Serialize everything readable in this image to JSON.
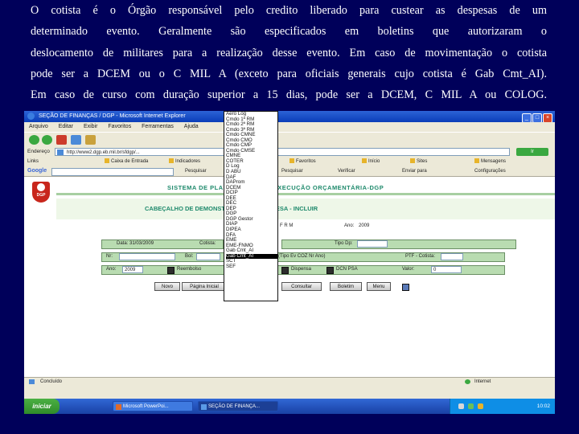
{
  "slide": {
    "lines": [
      "O cotista é o Órgão responsável pelo credito liberado para custear as despesas de um",
      "determinado evento. Geralmente são especificados em boletins que autorizaram o",
      "deslocamento de militares para a realização desse evento. Em caso de movimentação o cotista",
      "pode ser a DCEM ou o C MIL A (exceto para oficiais generais cujo cotista é Gab Cmt_AI).",
      "Em caso de curso com duração superior a 15 dias, pode ser a DCEM, C MIL A ou COLOG."
    ]
  },
  "window": {
    "title": "SEÇÃO DE FINANÇAS / DGP - Microsoft Internet Explorer",
    "menu": [
      "Arquivo",
      "Editar",
      "Exibir",
      "Favoritos",
      "Ferramentas",
      "Ajuda"
    ],
    "address_label": "Endereço",
    "address_value": "http://www2.dgp.eb.mil.br/sfdgp/...",
    "go_label": "Ir",
    "links": [
      "Links",
      "Caixa de Entrada",
      "Indicadores",
      "Favoritos",
      "Início",
      "Sites",
      "Mensagens"
    ],
    "google": {
      "logo": "Google",
      "items": [
        "Pesquisar",
        "Pesquisar",
        "Verificar",
        "Enviar para",
        "Configurações"
      ]
    }
  },
  "page": {
    "system_title": "SISTEMA DE PLANEJAMENTO E EXECUÇÃO ORÇAMENTÁRIA-DGP",
    "form_title": "CABEÇALHO DE DEMONSTRATIVO DA DESPESA - INCLUIR",
    "om_value": "F R M",
    "ano_label": "Ano:",
    "ano_value": "2009",
    "data_label": "Data: 31/03/2009",
    "cotista_label": "Cotista:",
    "tipo_label": "Tipo Dp:",
    "bol_label": "Bol:",
    "tipo_ev_label": "(Tipo Ev   COZ   Nr   Ano)",
    "ptf_label": "PTF - Cotista:",
    "nr_label": "Nr:",
    "ano2_label": "Ano:",
    "ano2_value": "2009",
    "check_labels": [
      "Reembolso",
      "Dispensa",
      "DCN PSA"
    ],
    "valor_label": "Valor:",
    "valor_value": "0",
    "buttons": [
      "Novo",
      "Página Inicial",
      "Consultar",
      "Boletim",
      "Menu"
    ],
    "dropdown_options": [
      "Aero Log",
      "Cmdo 1ª RM",
      "Cmdo 2ª RM",
      "Cmdo 3ª RM",
      "Cmdo CMNE",
      "Cmdo CMO",
      "Cmdo CMP",
      "Cmdo CMSE",
      "CMNE",
      "COTER",
      "D Log",
      "D ABU",
      "DAF",
      "DAProm",
      "DCEM",
      "DCIP",
      "DEE",
      "DEC",
      "DEP",
      "DGP",
      "DGP Gestor",
      "DIAP",
      "DIPEA",
      "DFA",
      "EME",
      "EME-FNMO",
      "Gab Cmt_AI",
      "Gab Cmt_AI",
      "SCT",
      "SEF"
    ],
    "dropdown_selected_index": 27
  },
  "status": {
    "left": "Concluído",
    "zone": "Internet"
  },
  "taskbar": {
    "start": "iniciar",
    "tasks": [
      "Microsoft PowerPoi...",
      "SEÇÃO DE FINANÇA..."
    ],
    "clock": "10:02"
  }
}
